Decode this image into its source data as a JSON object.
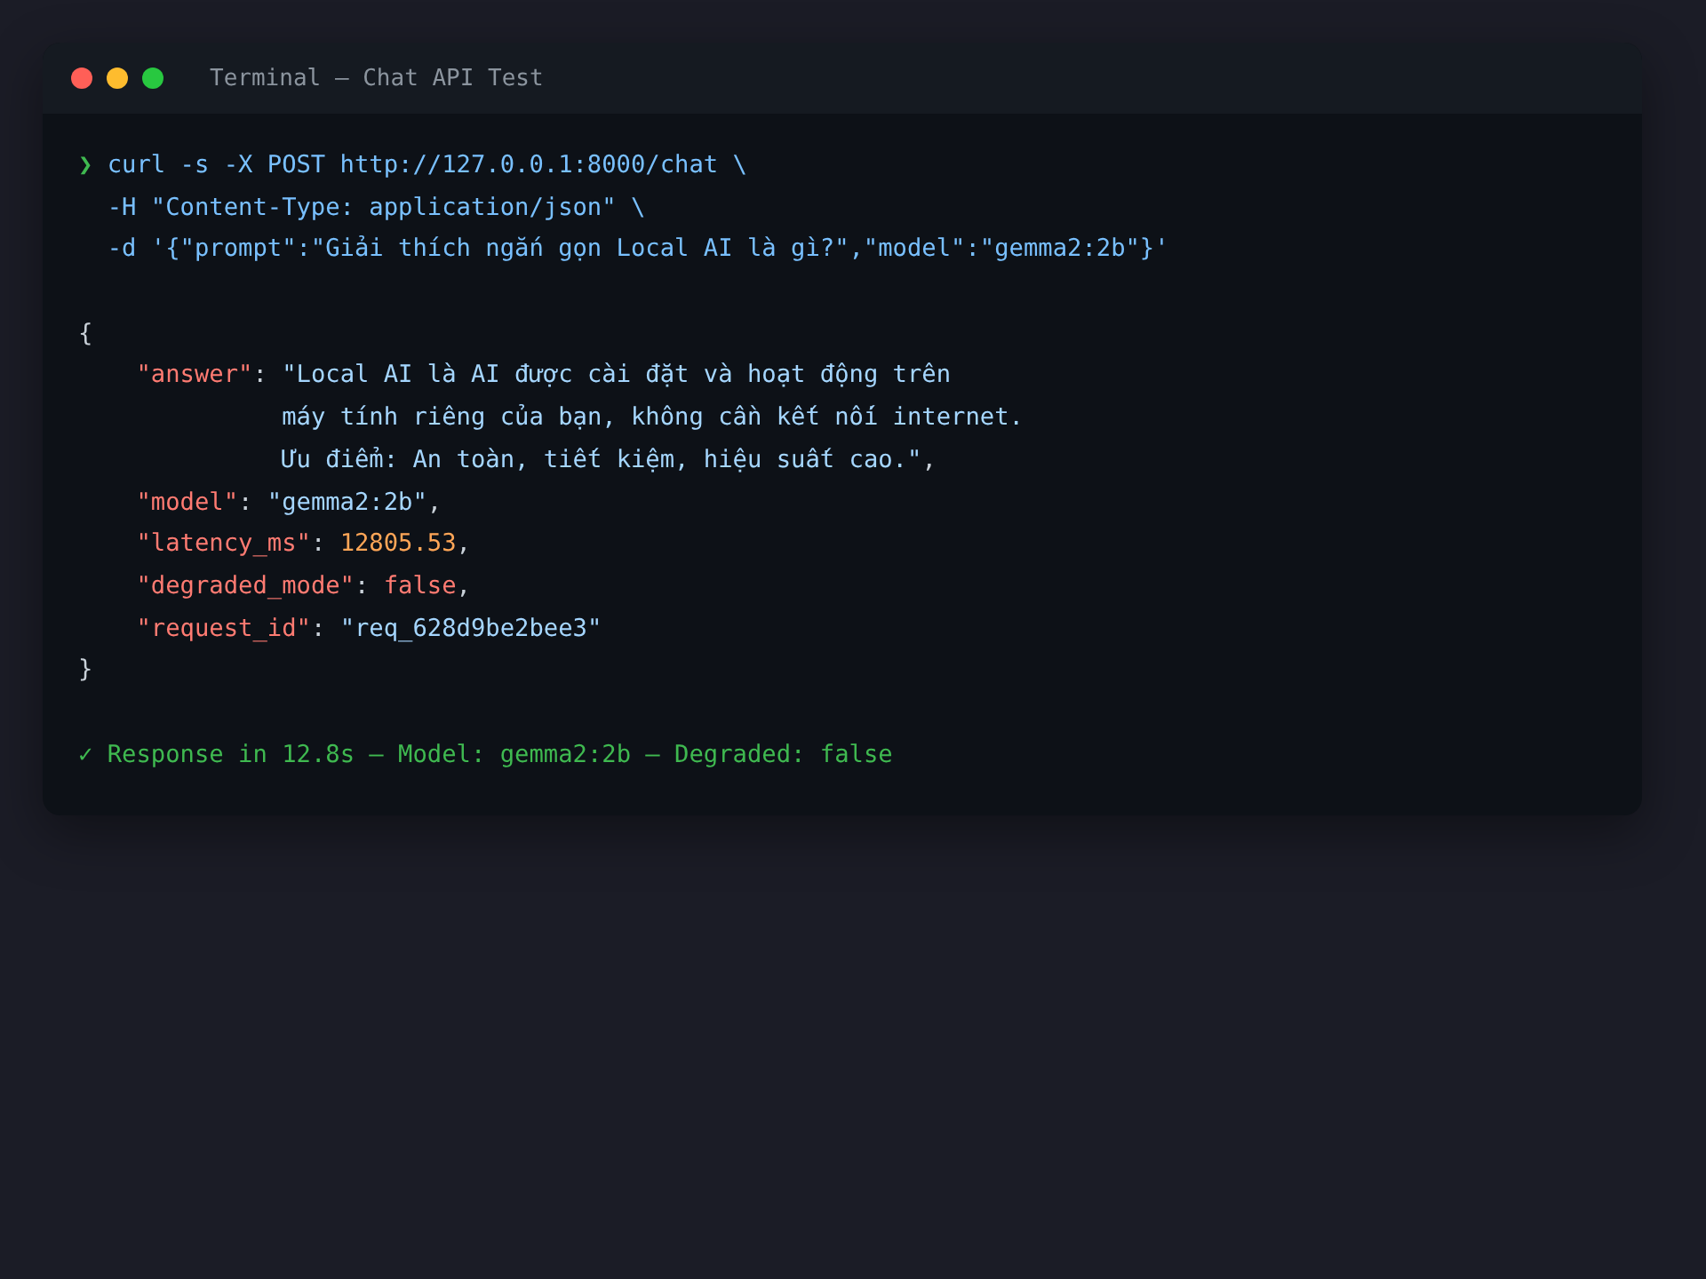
{
  "window": {
    "title": "Terminal — Chat API Test"
  },
  "command": {
    "prompt": "❯",
    "lines": [
      "curl -s -X POST http://127.0.0.1:8000/chat \\",
      "-H \"Content-Type: application/json\" \\",
      "-d '{\"prompt\":\"Giải thích ngắn gọn Local AI là gì?\",\"model\":\"gemma2:2b\"}'"
    ]
  },
  "response": {
    "open": "{",
    "close": "}",
    "fields": [
      {
        "key": "\"answer\"",
        "colon": ":",
        "kind": "string",
        "value_lines": [
          "\"Local AI là AI được cài đặt và hoạt động trên",
          "máy tính riêng của bạn, không cần kết nối internet.",
          "Ưu điểm: An toàn, tiết kiệm, hiệu suất cao.\""
        ],
        "comma": ","
      },
      {
        "key": "\"model\"",
        "colon": ":",
        "kind": "string",
        "value_lines": [
          "\"gemma2:2b\""
        ],
        "comma": ","
      },
      {
        "key": "\"latency_ms\"",
        "colon": ":",
        "kind": "number",
        "value_lines": [
          "12805.53"
        ],
        "comma": ","
      },
      {
        "key": "\"degraded_mode\"",
        "colon": ":",
        "kind": "boolean",
        "value_lines": [
          "false"
        ],
        "comma": ","
      },
      {
        "key": "\"request_id\"",
        "colon": ":",
        "kind": "string",
        "value_lines": [
          "\"req_628d9be2bee3\""
        ]
      }
    ]
  },
  "status": "✓ Response in 12.8s — Model: gemma2:2b — Degraded: false"
}
